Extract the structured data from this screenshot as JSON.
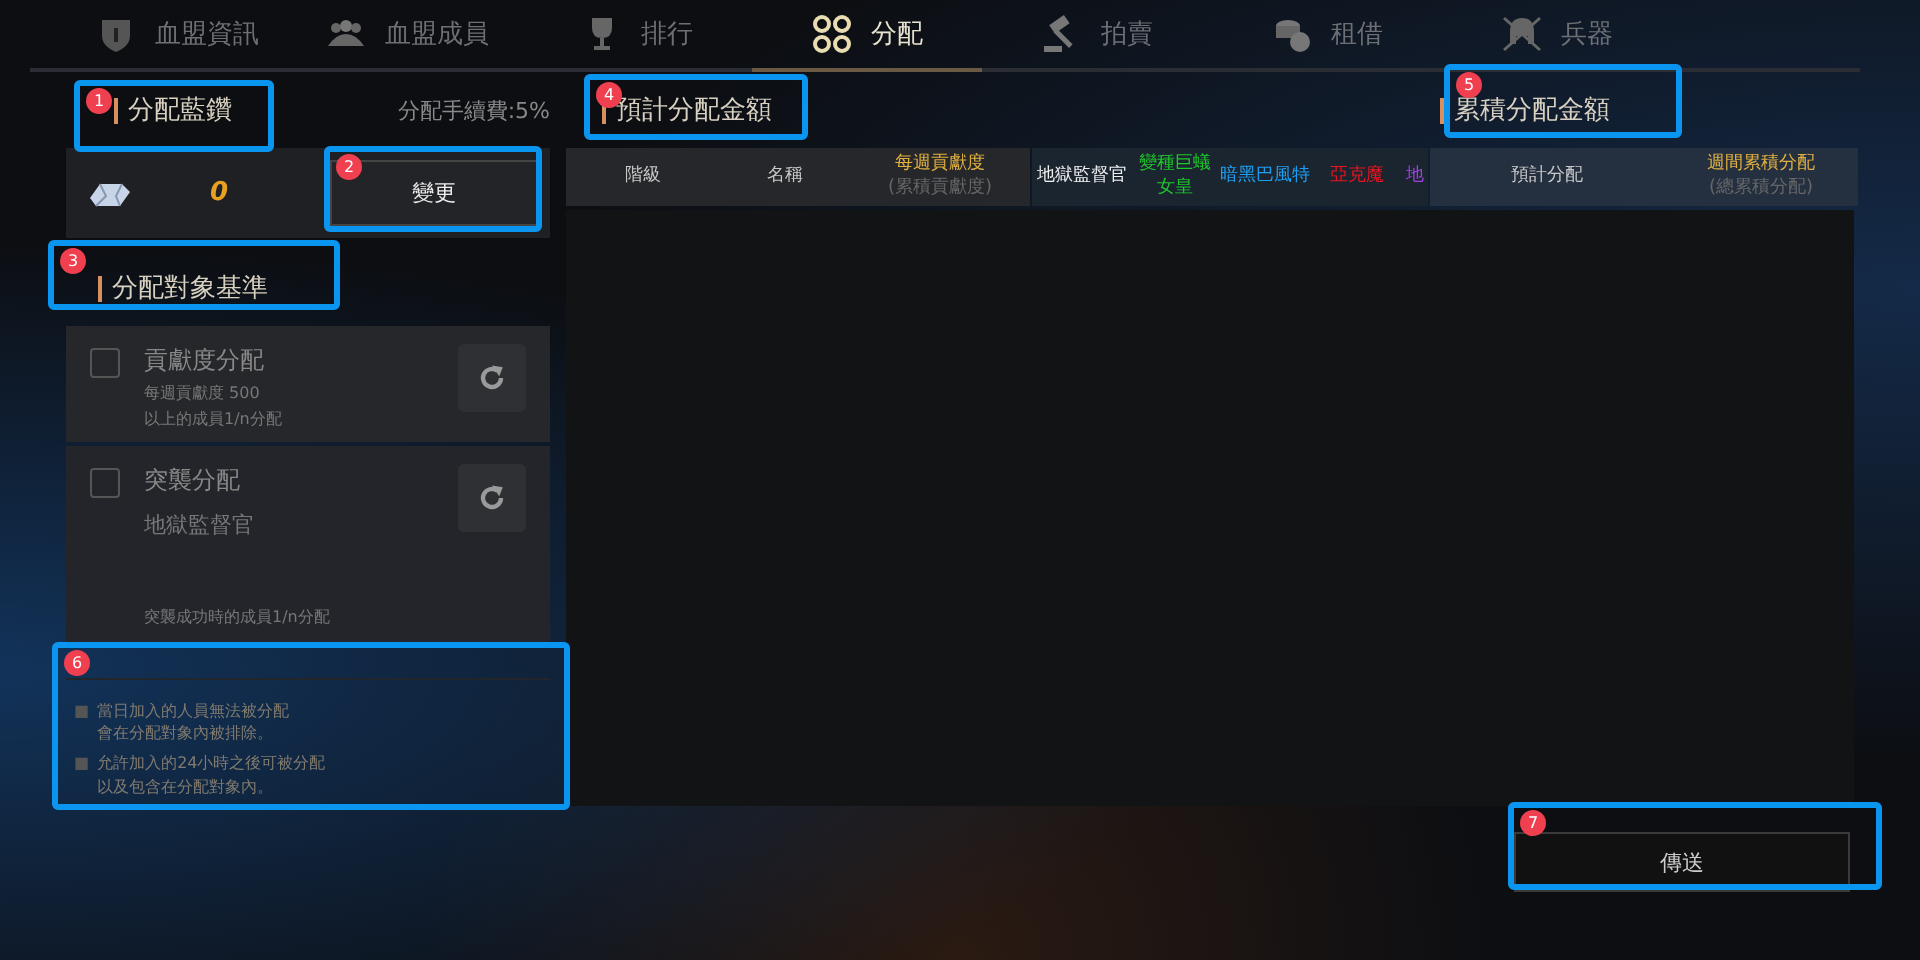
{
  "tabs": [
    {
      "label": "血盟資訊",
      "selected": false
    },
    {
      "label": "血盟成員",
      "selected": false
    },
    {
      "label": "排行",
      "selected": false
    },
    {
      "label": "分配",
      "selected": true
    },
    {
      "label": "拍賣",
      "selected": false
    },
    {
      "label": "租借",
      "selected": false
    },
    {
      "label": "兵器",
      "selected": false
    }
  ],
  "blue_diamond": {
    "title": "分配藍鑽",
    "fee": "分配手續費:5%",
    "amount": "0",
    "change_button": "變更"
  },
  "criteria": {
    "title": "分配對象基準",
    "options": [
      {
        "title": "貢獻度分配",
        "lines": [
          "每週貢獻度 500",
          "以上的成員1/n分配"
        ],
        "checked": false
      },
      {
        "title": "突襲分配",
        "subtitle": "地獄監督官",
        "lines": [
          "突襲成功時的成員1/n分配"
        ],
        "checked": false
      }
    ]
  },
  "notes": [
    {
      "mark": "■",
      "lines": [
        "當日加入的人員無法被分配",
        "會在分配對象內被排除。"
      ]
    },
    {
      "mark": "■",
      "lines": [
        "允許加入的24小時之後可被分配",
        "以及包含在分配對象內。"
      ]
    }
  ],
  "estimate_title": "預計分配金額",
  "cumulative_title": "累積分配金額",
  "table": {
    "groups": [
      {
        "columns": [
          {
            "label": "階級",
            "color": "#c8c8c8"
          },
          {
            "label": "名稱",
            "color": "#c8c8c8"
          },
          {
            "label": "每週貢獻度",
            "sub": "(累積貢獻度)",
            "color": "#e0b040"
          }
        ]
      },
      {
        "columns": [
          {
            "label": "地獄監督官",
            "color": "#f0f0f0"
          },
          {
            "label": "變種巨蟻女皇",
            "color": "#1ec82a"
          },
          {
            "label": "暗黑巴風特",
            "color": "#1e9ef0"
          },
          {
            "label": "亞克魔",
            "color": "#e8141e"
          },
          {
            "label": "地",
            "color": "#a040e0"
          }
        ]
      },
      {
        "columns": [
          {
            "label": "預計分配",
            "color": "#c8c8c8"
          },
          {
            "label": "週間累積分配",
            "sub": "(總累積分配)",
            "color": "#e0b040"
          }
        ]
      }
    ]
  },
  "send_button": "傳送",
  "callouts": [
    "1",
    "2",
    "3",
    "4",
    "5",
    "6",
    "7"
  ]
}
